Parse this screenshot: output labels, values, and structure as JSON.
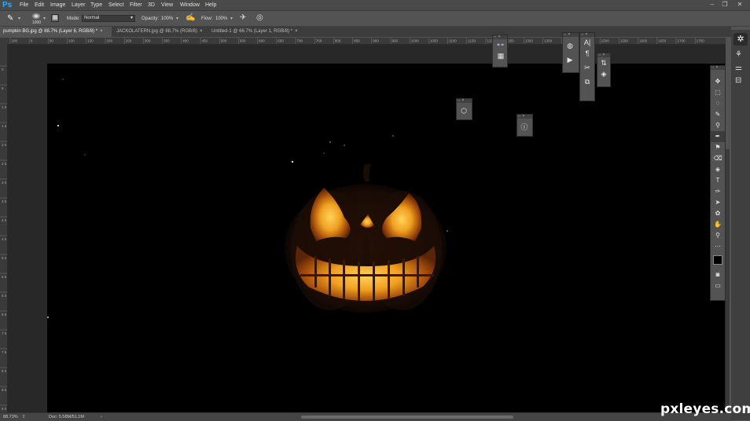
{
  "app": {
    "logo": "Ps",
    "menu": [
      "File",
      "Edit",
      "Image",
      "Layer",
      "Type",
      "Select",
      "Filter",
      "3D",
      "View",
      "Window",
      "Help"
    ]
  },
  "options_bar": {
    "brush_size": "1000",
    "mode_label": "Mode:",
    "mode_value": "Normal",
    "opacity_label": "Opacity:",
    "opacity_value": "100%",
    "flow_label": "Flow:",
    "flow_value": "100%"
  },
  "tabs": [
    {
      "label": "pumpkin BG.jpg @ 88.7% (Layer 6, RGB/8) *",
      "active": true
    },
    {
      "label": "JACKOLATERN.jpg @ 88.7% (RGB/8)",
      "active": false
    },
    {
      "label": "Untitled-1 @ 66.7% (Layer 1, RGB/8) *",
      "active": false
    }
  ],
  "ruler_h_ticks": [
    "100",
    "0",
    "50",
    "100",
    "150",
    "200",
    "250",
    "300",
    "350",
    "400",
    "450",
    "500",
    "550",
    "600",
    "650",
    "700",
    "750",
    "800",
    "850",
    "900",
    "950",
    "1000",
    "1050",
    "1100",
    "1150",
    "1200",
    "1250",
    "1300",
    "1350",
    "1400",
    "1450",
    "1500",
    "1550",
    "1600",
    "1650",
    "1700",
    "1750"
  ],
  "ruler_v_ticks": [
    "0",
    "5",
    "1 0",
    "1 5",
    "2 0",
    "2 5",
    "3 0",
    "3 5",
    "4 0",
    "4 5",
    "5 0",
    "5 5",
    "6 0",
    "6 5",
    "7 0",
    "7 5",
    "8 0",
    "8 5",
    "9 0"
  ],
  "status": {
    "zoom": "88.73%",
    "doc": "Doc: 5.58M/51.1M"
  },
  "watermark": "pxleyes.com",
  "colors": {
    "accent": "#31a8ff",
    "canvas_bg": "#000000",
    "pumpkin_glow": "#ffb020",
    "pumpkin_body": "#3a1a0a"
  },
  "icons": {
    "window_controls": [
      "minimize-icon",
      "restore-icon",
      "close-icon"
    ],
    "tools": [
      "move",
      "marquee",
      "lasso",
      "quick-select",
      "eyedropper",
      "brush",
      "stamp",
      "eraser",
      "paint-bucket",
      "type",
      "pen",
      "path-select",
      "shape",
      "hand",
      "zoom",
      "more",
      "color-swatches",
      "quick-mask",
      "screen-mode"
    ]
  }
}
